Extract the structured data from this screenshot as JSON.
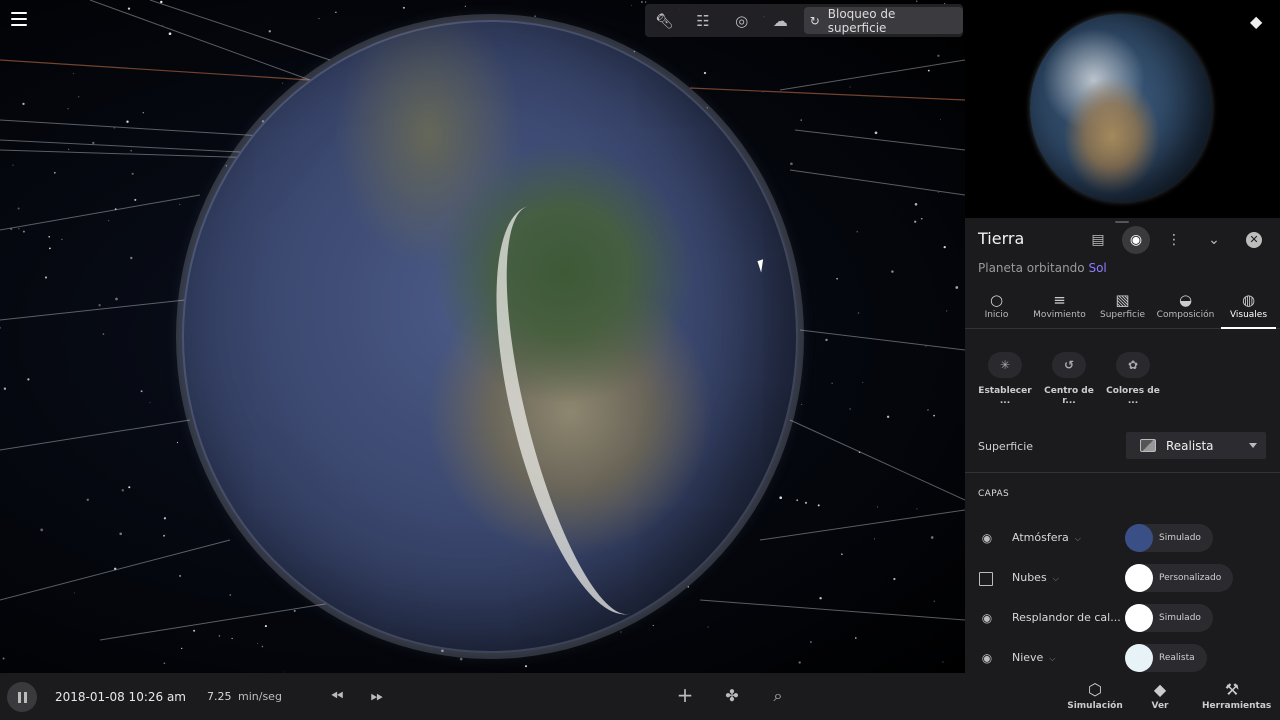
{
  "toolbar": {
    "flashlight_icon": "flashlight-icon",
    "sliders_icon": "sliders-icon",
    "orbit_icon": "orbit-icon",
    "cloud_icon": "cloud-icon",
    "surface_lock_label": "Bloqueo de superficie"
  },
  "panel": {
    "title": "Tierra",
    "subtitle_prefix": "Planeta orbitando",
    "subtitle_link": "Sol",
    "tabs": [
      {
        "label": "Inicio",
        "icon": "circle-icon"
      },
      {
        "label": "Movimiento",
        "icon": "motion-icon"
      },
      {
        "label": "Superficie",
        "icon": "surface-icon"
      },
      {
        "label": "Composición",
        "icon": "composition-icon"
      },
      {
        "label": "Visuales",
        "icon": "palette-icon",
        "active": true
      }
    ],
    "sub_actions": [
      {
        "label": "Establecer ...",
        "icon": "set-icon"
      },
      {
        "label": "Centro de r...",
        "icon": "center-icon"
      },
      {
        "label": "Colores de ...",
        "icon": "colors-icon"
      }
    ],
    "surface_label": "Superficie",
    "surface_value": "Realista",
    "layers_heading": "CAPAS",
    "layers": [
      {
        "name": "Atmósfera",
        "checked": true,
        "swatch": "#3a4f86",
        "mode": "Simulado"
      },
      {
        "name": "Nubes",
        "checked": false,
        "swatch": "#ffffff",
        "mode": "Personalizado"
      },
      {
        "name": "Resplandor de cal...",
        "checked": true,
        "swatch": "#ffffff",
        "mode": "Simulado"
      },
      {
        "name": "Nieve",
        "checked": true,
        "swatch": "#e8f3f8",
        "mode": "Realista"
      }
    ]
  },
  "bottombar": {
    "datetime": "2018-01-08 10:26 am",
    "rate": "7.25",
    "rate_unit": "min/seg",
    "right_buttons": [
      {
        "label": "Simulación",
        "icon": "cube-icon"
      },
      {
        "label": "Ver",
        "icon": "layers-icon"
      },
      {
        "label": "Herramientas",
        "icon": "wrench-icon"
      }
    ]
  },
  "colors": {
    "panel_bg": "#1b1b1d",
    "accent_link": "#8b7cff"
  }
}
